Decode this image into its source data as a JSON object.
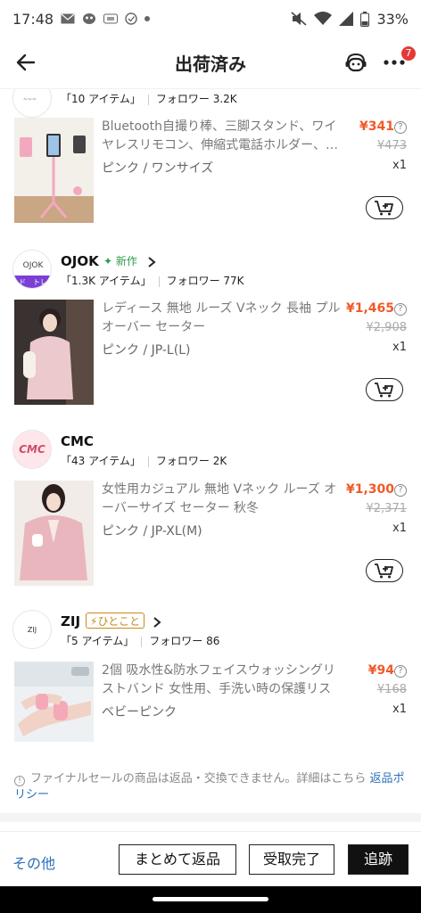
{
  "status_bar": {
    "time": "17:48",
    "battery": "33%"
  },
  "header": {
    "title": "出荷済み",
    "badge_count": "7"
  },
  "stores": [
    {
      "name": "",
      "logo_text": "",
      "items_count": "「10 アイテム」",
      "followers": "フォロワー 3.2K",
      "products": [
        {
          "name": "Bluetooth自撮り棒、三脚スタンド、ワイヤレスリモコン、伸縮式電話ホルダー、…",
          "variant": "ピンク / ワンサイズ",
          "price": "¥341",
          "original_price": "¥473",
          "qty": "x1"
        }
      ]
    },
    {
      "name": "OJOK",
      "logo_text": "OJOK",
      "logo_band": "ド　トレ",
      "tag": "新作",
      "items_count": "「1.3K アイテム」",
      "followers": "フォロワー 77K",
      "products": [
        {
          "name": "レディース 無地 ルーズ Vネック 長袖 プルオーバー セーター",
          "variant": "ピンク / JP-L(L)",
          "price": "¥1,465",
          "original_price": "¥2,908",
          "qty": "x1"
        }
      ]
    },
    {
      "name": "CMC",
      "logo_text": "CMC",
      "items_count": "「43 アイテム」",
      "followers": "フォロワー 2K",
      "products": [
        {
          "name": "女性用カジュアル 無地 Vネック ルーズ オーバーサイズ セーター 秋冬",
          "variant": "ピンク / JP-XL(M)",
          "price": "¥1,300",
          "original_price": "¥2,371",
          "qty": "x1"
        }
      ]
    },
    {
      "name": "ZIJ",
      "logo_text": "ZIJ",
      "tag": "ひとこと",
      "items_count": "「5 アイテム」",
      "followers": "フォロワー 86",
      "products": [
        {
          "name": "2個 吸水性&防水フェイスウォッシングリストバンド 女性用、手洗い時の保護リスト…",
          "variant": "ベビーピンク",
          "price": "¥94",
          "original_price": "¥168",
          "qty": "x1"
        }
      ]
    }
  ],
  "notice": {
    "text": "ファイナルセールの商品は返品・交換できません。詳細はこちら ",
    "link": "返品ポリシー"
  },
  "bottom_bar": {
    "other": "その他",
    "bulk_return": "まとめて返品",
    "received": "受取完了",
    "track": "追跡"
  },
  "colors": {
    "price": "#f05a28",
    "link": "#2a6fb8",
    "new_tag": "#2e9e48",
    "hitokoto_tag": "#c78a1a",
    "badge": "#e53935"
  }
}
